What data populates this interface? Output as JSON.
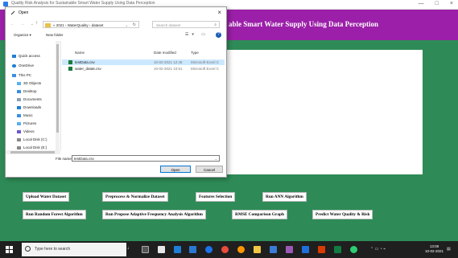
{
  "app": {
    "window_title": "Quality Risk Analysis for Sustainable Smart Water Supply Using Data Perception",
    "heading": "able Smart Water Supply Using Data Perception",
    "win_min": "—",
    "win_max": "□",
    "win_close": "×"
  },
  "buttons": {
    "upload": "Upload Water Dataset",
    "preprocess": "Preprocess & Normalize Dataset",
    "features": "Features Selection",
    "ann": "Run ANN Algorithm",
    "random_forest": "Run Random Forest Algorithm",
    "adaptive": "Run Propose Adaptive Frequency Analysis Algorithm",
    "rmse": "RMSE Comparison Graph",
    "predict": "Predict Water Quality & Risk"
  },
  "dialog": {
    "title": "Open",
    "close": "×",
    "address": "« 2021 › WaterQuality › dataset",
    "search_placeholder": "Search dataset",
    "organize": "Organize ▾",
    "new_folder": "New folder",
    "nav_items": [
      "Quick access",
      "OneDrive",
      "This PC",
      "3D Objects",
      "Desktop",
      "Documents",
      "Downloads",
      "Music",
      "Pictures",
      "Videos",
      "Local Disk (C:)",
      "Local Disk (E:)"
    ],
    "columns": {
      "name": "Name",
      "date": "Date modified",
      "type": "Type"
    },
    "files": [
      {
        "name": "testData.csv",
        "date": "10-02-2021 12:48",
        "type": "Microsoft Excel C",
        "selected": true
      },
      {
        "name": "water_data6.csv",
        "date": "10-02-2021 10:51",
        "type": "Microsoft Excel C",
        "selected": false
      }
    ],
    "file_name_label": "File name:",
    "file_name_value": "testData.csv",
    "open_label": "Open",
    "cancel_label": "Cancel"
  },
  "taskbar": {
    "search_placeholder": "Type here to search",
    "time": "13:08",
    "date": "10-02-2021"
  },
  "colors": {
    "header": "#9b1fa8",
    "body": "#2e8b57"
  }
}
